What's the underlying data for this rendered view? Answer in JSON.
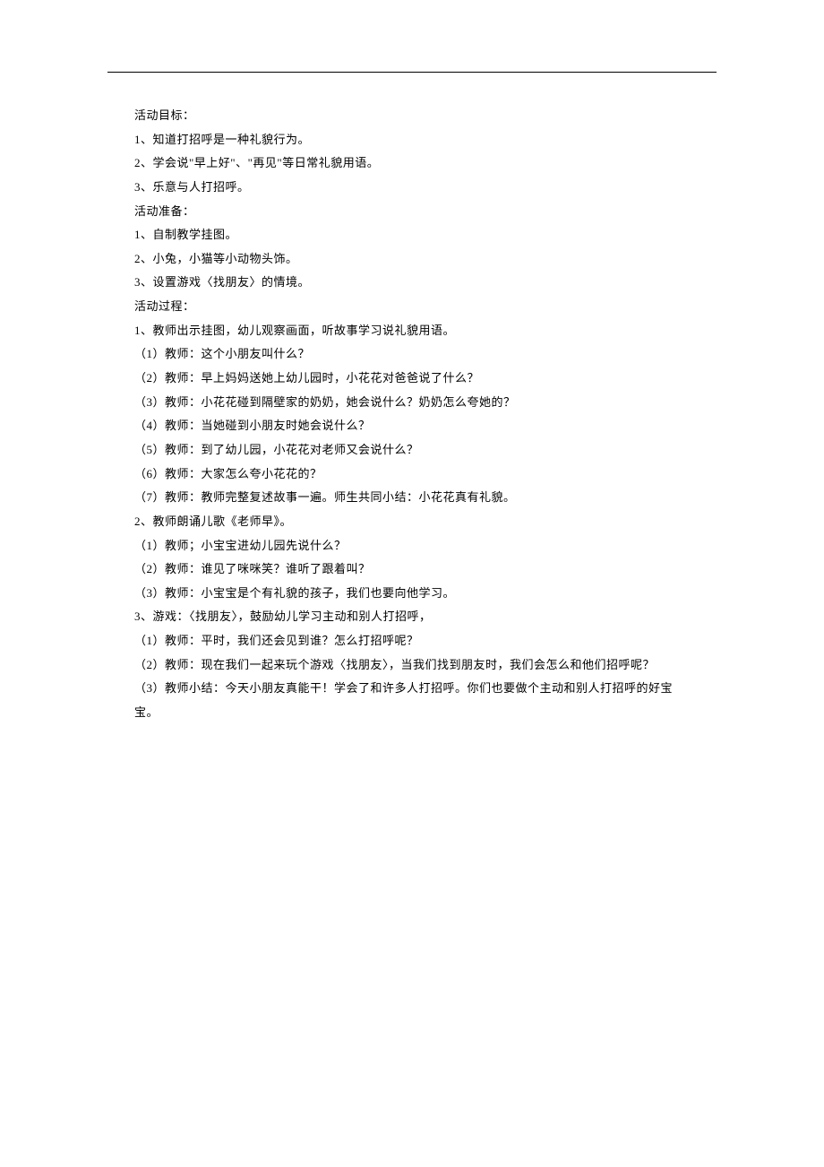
{
  "lines": [
    "活动目标：",
    "1、知道打招呼是一种礼貌行为。",
    "2、学会说\"早上好\"、\"再见\"等日常礼貌用语。",
    "3、乐意与人打招呼。",
    "活动准备：",
    "1、自制教学挂图。",
    "2、小兔，小猫等小动物头饰。",
    "3、设置游戏〈找朋友〉的情境。",
    "活动过程：",
    "1、教师出示挂图，幼儿观察画面，听故事学习说礼貌用语。",
    "（1）教师：这个小朋友叫什么？",
    "（2）教师：早上妈妈送她上幼儿园时，小花花对爸爸说了什么？",
    "（3）教师：小花花碰到隔壁家的奶奶，她会说什么？奶奶怎么夸她的？",
    "（4）教师：当她碰到小朋友时她会说什么？",
    "（5）教师：到了幼儿园，小花花对老师又会说什么？",
    "（6）教师：大家怎么夸小花花的？",
    "（7）教师：教师完整复述故事一遍。师生共同小结：小花花真有礼貌。",
    "2、教师朗诵儿歌《老师早》。",
    "（1）教师；小宝宝进幼儿园先说什么？",
    "（2）教师：谁见了咪咪笑？谁听了跟着叫？",
    "（3）教师：小宝宝是个有礼貌的孩子，我们也要向他学习。",
    "3、游戏：〈找朋友〉，鼓励幼儿学习主动和别人打招呼，",
    "（1）教师：平时，我们还会见到谁？怎么打招呼呢？",
    "（2）教师：现在我们一起来玩个游戏〈找朋友〉，当我们找到朋友时，我们会怎么和他们招呼呢？",
    "（3）教师小结：今天小朋友真能干！学会了和许多人打招呼。你们也要做个主动和别人打招呼的好宝宝。"
  ]
}
